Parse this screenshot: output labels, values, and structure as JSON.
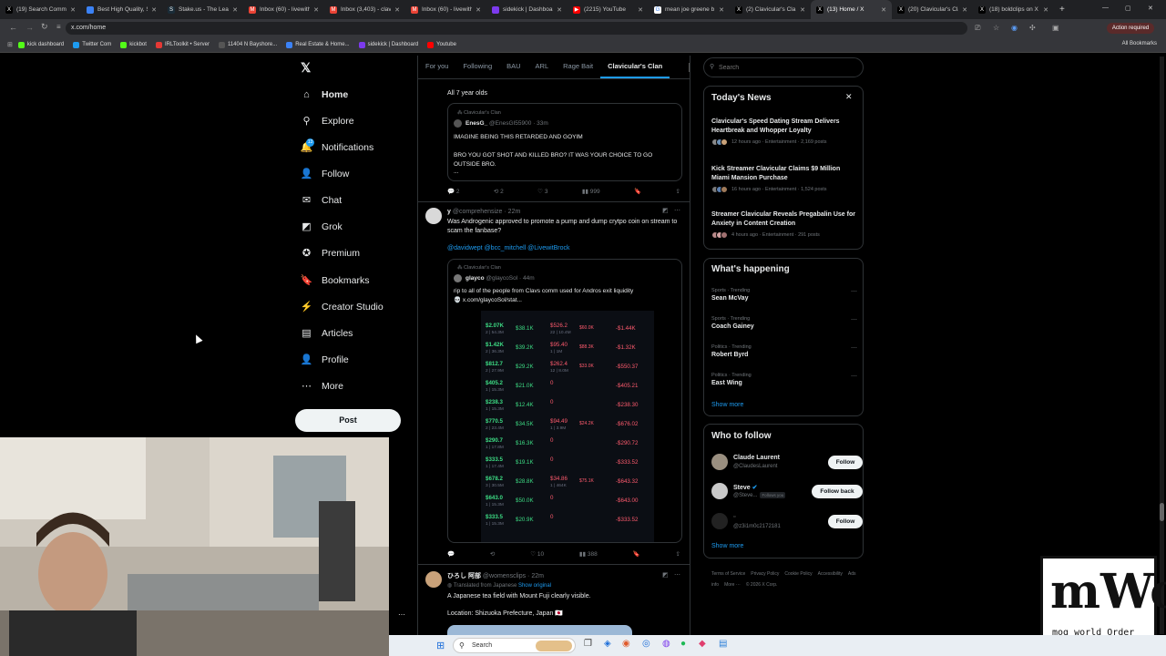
{
  "browser": {
    "tabs": [
      {
        "label": "(19) Search Commu",
        "fav": "X",
        "color": "#000000",
        "active": false
      },
      {
        "label": "Best High Quality, S",
        "fav": "",
        "color": "#3b82f6",
        "active": false
      },
      {
        "label": "Stake.us - The Lead",
        "fav": "S",
        "color": "#1a2c38",
        "active": false
      },
      {
        "label": "Inbox (60) - livewith",
        "fav": "M",
        "color": "#ea4335",
        "active": false
      },
      {
        "label": "Inbox (3,403) - clavi",
        "fav": "M",
        "color": "#ea4335",
        "active": false
      },
      {
        "label": "Inbox (60) - livewith",
        "fav": "M",
        "color": "#ea4335",
        "active": false
      },
      {
        "label": "sidekick | Dashboard",
        "fav": "",
        "color": "#7c3aed",
        "active": false
      },
      {
        "label": "(2215) YouTube",
        "fav": "▶",
        "color": "#ff0000",
        "active": false
      },
      {
        "label": "mean joe greene b",
        "fav": "G",
        "color": "#ffffff",
        "active": false
      },
      {
        "label": "(2) Clavicular's Cla",
        "fav": "X",
        "color": "#000000",
        "active": false
      },
      {
        "label": "(13) Home / X",
        "fav": "X",
        "color": "#000000",
        "active": true
      },
      {
        "label": "(20) Clavicular's Cla",
        "fav": "X",
        "color": "#000000",
        "active": false
      },
      {
        "label": "(18) boldclips on X",
        "fav": "X",
        "color": "#000000",
        "active": false
      }
    ],
    "url": "x.com/home",
    "action_required": "Action required",
    "bookmarks": [
      {
        "label": "kick dashboard",
        "color": "#53fc18"
      },
      {
        "label": "Twitter Com",
        "color": "#1d9bf0"
      },
      {
        "label": "kickbot",
        "color": "#53fc18"
      },
      {
        "label": "IRLToolkit • Server",
        "color": "#e53935"
      },
      {
        "label": "11404 N Bayshore...",
        "color": "#555555"
      },
      {
        "label": "Real Estate & Home...",
        "color": "#3b82f6"
      },
      {
        "label": "sidekick | Dashboard",
        "color": "#7c3aed"
      },
      {
        "label": "Youtube",
        "color": "#ff0000"
      }
    ],
    "all_bookmarks": "All Bookmarks"
  },
  "nav": {
    "items": [
      {
        "label": "Home",
        "icon": "home-icon",
        "glyph": "⌂",
        "bold": true
      },
      {
        "label": "Explore",
        "icon": "search-icon",
        "glyph": "⚲",
        "bold": false
      },
      {
        "label": "Notifications",
        "icon": "bell-icon",
        "glyph": "🔔",
        "bold": false
      },
      {
        "label": "Follow",
        "icon": "person-plus-icon",
        "glyph": "👤",
        "bold": false
      },
      {
        "label": "Chat",
        "icon": "mail-icon",
        "glyph": "✉",
        "bold": false
      },
      {
        "label": "Grok",
        "icon": "grok-icon",
        "glyph": "◩",
        "bold": false
      },
      {
        "label": "Premium",
        "icon": "premium-icon",
        "glyph": "✪",
        "bold": false
      },
      {
        "label": "Bookmarks",
        "icon": "bookmark-icon",
        "glyph": "🔖",
        "bold": false
      },
      {
        "label": "Creator Studio",
        "icon": "creator-studio-icon",
        "glyph": "⚡",
        "bold": false
      },
      {
        "label": "Articles",
        "icon": "articles-icon",
        "glyph": "▤",
        "bold": false
      },
      {
        "label": "Profile",
        "icon": "person-icon",
        "glyph": "👤",
        "bold": false
      },
      {
        "label": "More",
        "icon": "more-icon",
        "glyph": "⋯",
        "bold": false
      }
    ],
    "notifications_badge": "13",
    "post_label": "Post"
  },
  "feed": {
    "tabs": [
      "For you",
      "Following",
      "BAU",
      "ARL",
      "Rage Bait",
      "Clavicular's Clan"
    ],
    "active_tab": "Clavicular's Clan",
    "tweet1": {
      "text": "All 7 year olds",
      "quote_community": "Clavicular's Clan",
      "quote_name": "EnesG_",
      "quote_handle": "@EnesGI55900",
      "quote_time": "33m",
      "quote_text1": "IMAGINE BEING THIS RETARDED AND GOYIM",
      "quote_text2": "BRO YOU GOT SHOT AND KILLED BRO? IT WAS YOUR CHOICE TO GO OUTSIDE BRO.",
      "quote_text3": "...",
      "replies": "2",
      "reposts": "2",
      "likes": "3",
      "views": "999"
    },
    "tweet2": {
      "name": "y",
      "handle": "@comprehensize",
      "time": "22m",
      "text": "Was Androgenic approved to promote a pump and dump crytpo coin on stream to scam the fanbase?",
      "mentions": "@davidwept @bcc_mitchell @LivewitBrock",
      "quote_community": "Clavicular's Clan",
      "quote_name": "glayco",
      "quote_handle": "@glaycoSol",
      "quote_time": "44m",
      "quote_text": "rip to all of the people from Clavs comm used for Andros exit liquidity",
      "quote_link": "x.com/glaycoSol/stat...",
      "replies": "",
      "reposts": "",
      "likes": "10",
      "views": "388",
      "table_rows": [
        {
          "a": "$2.07K",
          "as": "2 | 54.3M",
          "b": "$38.1K",
          "c": "$526.2",
          "cs": "22 | 10.4M",
          "d": "$60.0K",
          "e": "-$1.44K"
        },
        {
          "a": "$1.42K",
          "as": "2 | 36.3M",
          "b": "$39.2K",
          "c": "$95.40",
          "cs": "1 | 1M",
          "d": "$88.3K",
          "e": "-$1.32K"
        },
        {
          "a": "$812.7",
          "as": "2 | 27.9M",
          "b": "$29.2K",
          "c": "$262.4",
          "cs": "12 | 8.0M",
          "d": "$33.0K",
          "e": "-$550.37"
        },
        {
          "a": "$405.2",
          "as": "1 | 15.3M",
          "b": "$21.0K",
          "c": "0",
          "cs": "",
          "d": "",
          "e": "-$405.21"
        },
        {
          "a": "$238.3",
          "as": "1 | 15.3M",
          "b": "$12.4K",
          "c": "0",
          "cs": "",
          "d": "",
          "e": "-$238.30"
        },
        {
          "a": "$770.5",
          "as": "2 | 23.4M",
          "b": "$34.5K",
          "c": "$94.49",
          "cs": "1 | 3.9M",
          "d": "$24.2K",
          "e": "-$676.02"
        },
        {
          "a": "$290.7",
          "as": "1 | 17.8M",
          "b": "$16.3K",
          "c": "0",
          "cs": "",
          "d": "",
          "e": "-$290.72"
        },
        {
          "a": "$333.5",
          "as": "1 | 17.4M",
          "b": "$19.1K",
          "c": "0",
          "cs": "",
          "d": "",
          "e": "-$333.52"
        },
        {
          "a": "$678.2",
          "as": "3 | 30.5M",
          "b": "$28.8K",
          "c": "$34.86",
          "cs": "1 | 464K",
          "d": "$75.1K",
          "e": "-$643.32"
        },
        {
          "a": "$643.0",
          "as": "1 | 15.3M",
          "b": "$50.0K",
          "c": "0",
          "cs": "",
          "d": "",
          "e": "-$643.00"
        },
        {
          "a": "$333.5",
          "as": "1 | 15.3M",
          "b": "$20.9K",
          "c": "0",
          "cs": "",
          "d": "",
          "e": "-$333.52"
        }
      ]
    },
    "tweet3": {
      "name": "ひろし 阿部",
      "handle": "@womensclips",
      "time": "22m",
      "translated": "Translated from Japanese",
      "show_original": "Show original",
      "text": "A Japanese tea field with Mount Fuji clearly visible.",
      "location": "Location: Shizuoka Prefecture, Japan 🇯🇵"
    }
  },
  "sidebar": {
    "search_placeholder": "Search",
    "today_news": {
      "title": "Today's News",
      "items": [
        {
          "title": "Clavicular's Speed Dating Stream Delivers Heartbreak and Whopper Loyalty",
          "meta": "12 hours ago · Entertainment · 2,169 posts"
        },
        {
          "title": "Kick Streamer Clavicular Claims $9 Million Miami Mansion Purchase",
          "meta": "16 hours ago · Entertainment · 1,524 posts"
        },
        {
          "title": "Streamer Clavicular Reveals Pregabalin Use for Anxiety in Content Creation",
          "meta": "4 hours ago · Entertainment · 291 posts"
        }
      ]
    },
    "whats_happening": {
      "title": "What's happening",
      "items": [
        {
          "cat": "Sports · Trending",
          "name": "Sean McVay"
        },
        {
          "cat": "Sports · Trending",
          "name": "Coach Gainey"
        },
        {
          "cat": "Politics · Trending",
          "name": "Robert Byrd"
        },
        {
          "cat": "Politics · Trending",
          "name": "East Wing"
        }
      ],
      "show_more": "Show more"
    },
    "who_to_follow": {
      "title": "Who to follow",
      "users": [
        {
          "name": "Claude Laurent",
          "handle": "@ClaudesLaurent",
          "button": "Follow"
        },
        {
          "name": "Steve",
          "handle": "@Steve...",
          "badge": "Follows you",
          "button": "Follow back"
        },
        {
          "name": "",
          "handle": "@z3i1m0c2172181",
          "button": "Follow"
        }
      ],
      "show_more": "Show more"
    },
    "footer": [
      "Terms of Service",
      "Privacy Policy",
      "Cookie Policy",
      "Accessibility",
      "Ads info",
      "More ···",
      "© 2026 X Corp."
    ]
  },
  "taskbar": {
    "search": "Search"
  },
  "overlay": {
    "logo_text": "mog world Order"
  }
}
